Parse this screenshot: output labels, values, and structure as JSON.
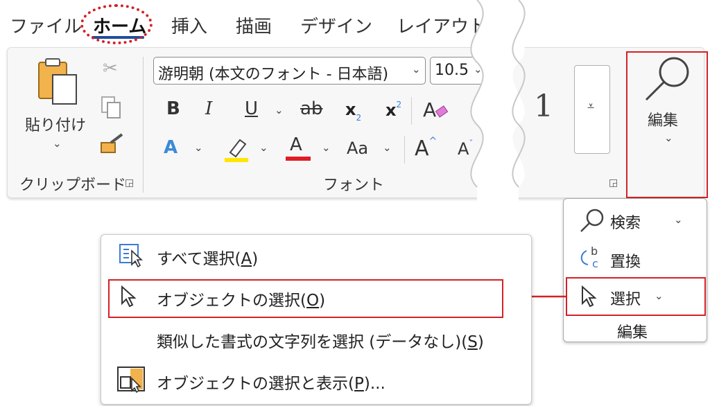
{
  "tabs": [
    "ファイル",
    "ホーム",
    "挿入",
    "描画",
    "デザイン",
    "レイアウト"
  ],
  "clipboard": {
    "paste_label": "貼り付け",
    "group_label": "クリップボード"
  },
  "font": {
    "font_name": "游明朝 (本文のフォント - 日本語)",
    "font_size": "10.5",
    "bold": "B",
    "italic": "I",
    "underline": "U",
    "strike": "ab",
    "subscript": "x",
    "subscript_mark": "2",
    "superscript": "x",
    "superscript_mark": "2",
    "text_effect": "A",
    "font_color": "A",
    "change_case": "Aa",
    "grow_font": "A",
    "shrink_font": "A",
    "group_label": "フォント",
    "highlight_color": "#ffe600",
    "font_color_bar": "#e01c24"
  },
  "styles": {
    "style_number": "1"
  },
  "editing_group": {
    "label": "編集"
  },
  "editing_panel": {
    "find": "検索",
    "replace": "置換",
    "select": "選択",
    "group_label": "編集"
  },
  "select_menu": {
    "select_all": "すべて選択",
    "select_all_key": "A",
    "select_objects": "オブジェクトの選択",
    "select_objects_key": "O",
    "select_similar": "類似した書式の文字列を選択 (データなし)",
    "select_similar_key": "S",
    "selection_pane": "オブジェクトの選択と表示",
    "selection_pane_key": "P",
    "ellipsis": "..."
  },
  "colors": {
    "annotation_red": "#d42027",
    "home_underline": "#1f4e9c",
    "ribbon_bg": "#f7f7f7"
  }
}
